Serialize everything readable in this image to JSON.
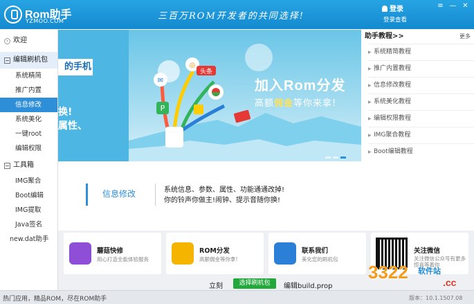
{
  "app": {
    "logo_name": "Rom助手",
    "logo_site": "YZMOO.COM",
    "slogan": "三百万ROM开发者的共同选择!",
    "login": "登录",
    "register": "登录查看"
  },
  "sidebar": {
    "groups": [
      {
        "label": "欢迎"
      },
      {
        "label": "编辑刷机包"
      },
      {
        "label": "工具箱"
      }
    ],
    "edit_items": [
      "系统精简",
      "推广内置",
      "信息修改",
      "系统美化",
      "一键root",
      "编辑权限"
    ],
    "tool_items": [
      "IMG聚合",
      "Boot编辑",
      "IMG提取",
      "Java签名",
      "new.dat助手"
    ]
  },
  "banner": {
    "left_title": "的手机",
    "left_line1": "换!",
    "left_line2": "属性、",
    "tag": "头条",
    "promo_title": "加入Rom分发",
    "promo_sub_a": "高额",
    "promo_sub_b": "佣金",
    "promo_sub_c": "等你来拿!"
  },
  "tutorials": {
    "title": "助手教程>>",
    "more": "更多",
    "items": [
      "系统精简教程",
      "推广内置教程",
      "信息修改教程",
      "系统美化教程",
      "编辑权限教程",
      "IMG聚合教程",
      "Boot编辑教程"
    ]
  },
  "info": {
    "title": "信息修改",
    "line1": "系统信息、参数、属性、功能通通改掉!",
    "line2": "你的铃声你做主!闹钟、提示音随你换!"
  },
  "cards": [
    {
      "title": "蘑菇快修",
      "sub": "用心打造全能体验服务",
      "color": "#8e4fd6"
    },
    {
      "title": "ROM分发",
      "sub": "高额佣金等你拿!",
      "color": "#f4b400"
    },
    {
      "title": "联系我们",
      "sub": "美化您的刷机包",
      "color": "#2b7fd6"
    },
    {
      "title": "关注微信",
      "sub": "关注微信公众号有更多惊喜等着你"
    }
  ],
  "actions": {
    "left": "立刻",
    "button": "选择刷机包",
    "right": "编辑build.prop"
  },
  "status": {
    "left": "热门应用，精品ROM，尽在ROM助手",
    "version": "版本：10.1.1507.08"
  },
  "watermark": {
    "num": "3322",
    "sub": "软件站",
    "cc": ".cc"
  },
  "colors": {
    "title_bar": "#1a93d8",
    "accent": "#2e8fd8",
    "button_green": "#23a83b"
  }
}
